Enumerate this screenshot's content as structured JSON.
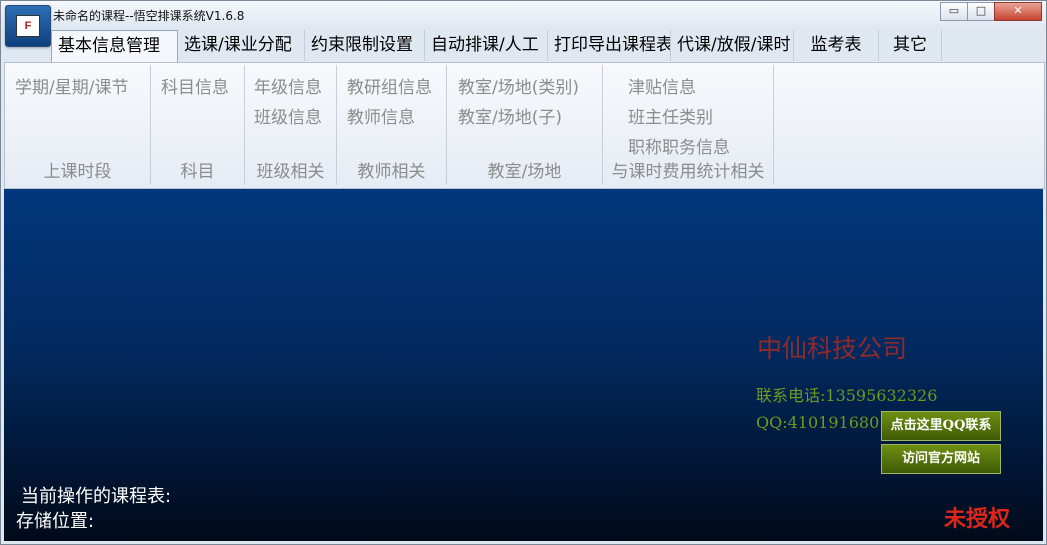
{
  "window": {
    "title": "未命名的课程--悟空排课系统V1.6.8",
    "app_icon_letter": "F",
    "minimize_label": "▭",
    "maximize_label": "□",
    "close_label": "✕"
  },
  "tabs": [
    {
      "label": "基本信息管理"
    },
    {
      "label": "选课/课业分配"
    },
    {
      "label": "约束限制设置"
    },
    {
      "label": "自动排课/人工"
    },
    {
      "label": "打印导出课程表"
    },
    {
      "label": "代课/放假/课时"
    },
    {
      "label": "监考表"
    },
    {
      "label": "其它"
    }
  ],
  "ribbon": {
    "groups": [
      {
        "label": "上课时段",
        "items": [
          "学期/星期/课节"
        ]
      },
      {
        "label": "科目",
        "items": [
          "科目信息"
        ]
      },
      {
        "label": "班级相关",
        "items": [
          "年级信息",
          "班级信息"
        ]
      },
      {
        "label": "教师相关",
        "items": [
          "教研组信息",
          "教师信息"
        ]
      },
      {
        "label": "教室/场地",
        "items": [
          "教室/场地(类别)",
          "教室/场地(子)"
        ]
      },
      {
        "label": "与课时费用统计相关",
        "items": [
          "津贴信息",
          "班主任类别",
          "职称职务信息"
        ]
      }
    ]
  },
  "main": {
    "company": "中仙科技公司",
    "phone": "联系电话:13595632326",
    "qq": "QQ:410191680",
    "qq_button": "点击这里QQ联系",
    "website_button": "访问官方网站",
    "current_schedule_label": "当前操作的课程表:",
    "storage_label": "存储位置:",
    "license_status": "未授权"
  }
}
